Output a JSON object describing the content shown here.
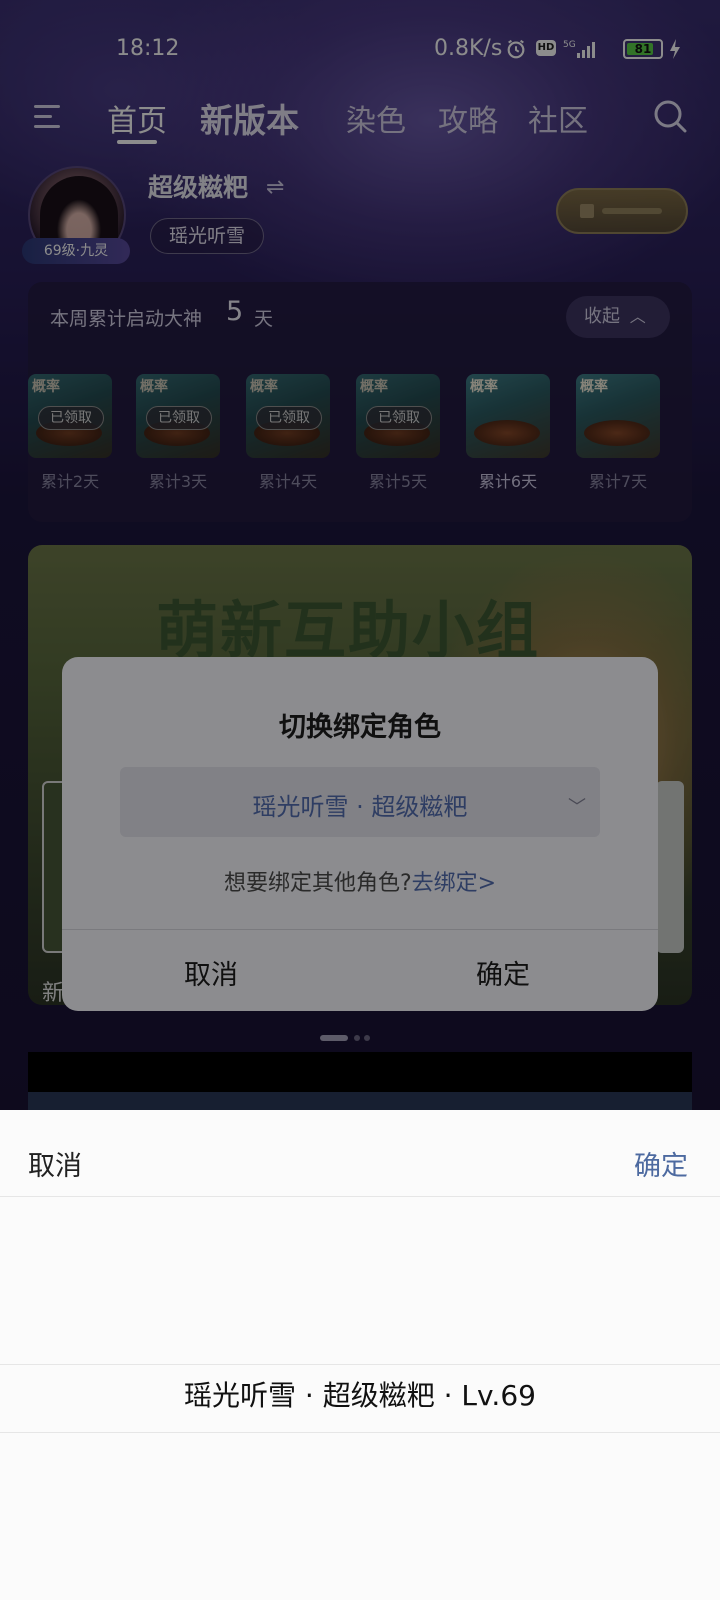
{
  "status_bar": {
    "time": "18:12",
    "network_speed": "0.8K/s",
    "battery": "81",
    "icons": [
      "alarm-icon",
      "hd-icon",
      "5g-signal-icon",
      "battery-icon",
      "charging-icon"
    ]
  },
  "nav": {
    "tabs": [
      {
        "label": "首页"
      },
      {
        "label": "新版本"
      },
      {
        "label": "染色"
      },
      {
        "label": "攻略"
      },
      {
        "label": "社区"
      }
    ]
  },
  "profile": {
    "name": "超级糍粑",
    "level_badge": "69级·九灵",
    "server": "瑶光听雪",
    "swap_symbol": "⇌"
  },
  "weekly": {
    "prefix": "本周累计启动大神",
    "days": "5",
    "unit": "天",
    "collapse_label": "收起",
    "rewards": [
      {
        "tag": "概率",
        "status": "已领取",
        "label": "累计2天"
      },
      {
        "tag": "概率",
        "status": "已领取",
        "label": "累计3天"
      },
      {
        "tag": "概率",
        "status": "已领取",
        "label": "累计4天"
      },
      {
        "tag": "概率",
        "status": "已领取",
        "label": "累计5天"
      },
      {
        "tag": "概率",
        "status": "",
        "label": "累计6天"
      },
      {
        "tag": "概率",
        "status": "",
        "label": "累计7天"
      }
    ]
  },
  "banner": {
    "title": "萌新互助小组",
    "side_text": "新"
  },
  "dialog": {
    "title": "切换绑定角色",
    "selected_role": "瑶光听雪 · 超级糍粑",
    "hint": "想要绑定其他角色?",
    "hint_link": "去绑定>",
    "cancel": "取消",
    "confirm": "确定"
  },
  "sheet": {
    "cancel": "取消",
    "confirm": "确定",
    "option": "瑶光听雪 · 超级糍粑 · Lv.69"
  },
  "colors": {
    "accent_link": "#4d6aa0",
    "dialog_bg": "#8c8c8f",
    "battery_green": "#5bd14a"
  }
}
